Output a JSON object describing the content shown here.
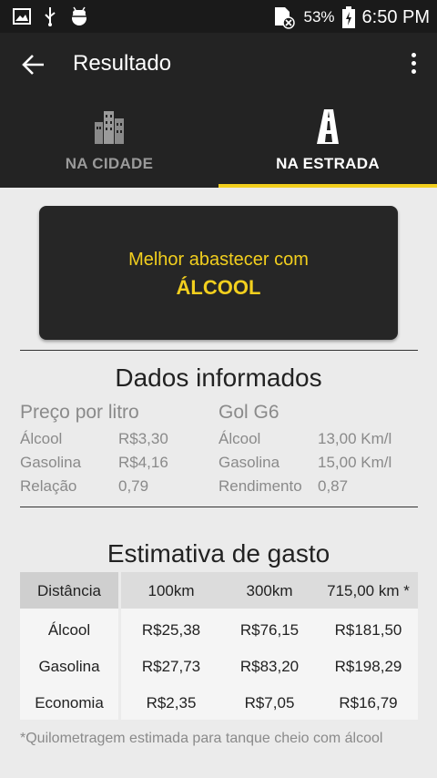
{
  "status_bar": {
    "battery": "53%",
    "time": "6:50 PM",
    "icons": [
      "image-icon",
      "usb-icon",
      "android-debug-icon",
      "no-sim-icon",
      "battery-charging-icon"
    ]
  },
  "app_bar": {
    "title": "Resultado",
    "back_icon": "arrow-back-icon",
    "menu_icon": "overflow-menu-icon"
  },
  "tabs": [
    {
      "label": "NA CIDADE",
      "icon": "city-buildings-icon",
      "selected": false
    },
    {
      "label": "NA ESTRADA",
      "icon": "road-icon",
      "selected": true
    }
  ],
  "result": {
    "line1": "Melhor abastecer com",
    "line2": "ÁLCOOL"
  },
  "dados": {
    "title": "Dados informados",
    "prices": {
      "header": "Preço por litro",
      "rows": [
        {
          "label": "Álcool",
          "value": "R$3,30"
        },
        {
          "label": "Gasolina",
          "value": "R$4,16"
        },
        {
          "label": "Relação",
          "value": "0,79"
        }
      ]
    },
    "car": {
      "header": "Gol G6",
      "rows": [
        {
          "label": "Álcool",
          "value": "13,00 Km/l"
        },
        {
          "label": "Gasolina",
          "value": "15,00 Km/l"
        },
        {
          "label": "Rendimento",
          "value": "0,87"
        }
      ]
    }
  },
  "estimativa": {
    "title": "Estimativa de gasto",
    "columns": [
      "Distância",
      "100km",
      "300km",
      "715,00 km *"
    ],
    "rows": [
      [
        "Álcool",
        "R$25,38",
        "R$76,15",
        "R$181,50"
      ],
      [
        "Gasolina",
        "R$27,73",
        "R$83,20",
        "R$198,29"
      ],
      [
        "Economia",
        "R$2,35",
        "R$7,05",
        "R$16,79"
      ]
    ]
  },
  "footnote": "*Quilometragem estimada para tanque cheio com álcool",
  "colors": {
    "accent": "#f2cf1e",
    "bar": "#232323",
    "background": "#ebebeb"
  }
}
